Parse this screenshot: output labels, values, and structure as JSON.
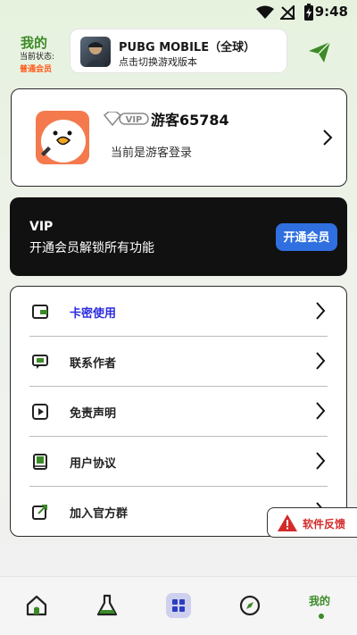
{
  "status_bar": {
    "time": "9:48",
    "icons": [
      "wifi-icon",
      "signal-off-icon",
      "battery-charging-icon"
    ]
  },
  "header": {
    "title": "我的",
    "status_label": "当前状态:",
    "member_level": "普通会员"
  },
  "game_switch": {
    "name": "PUBG MOBILE（全球）",
    "subtitle": "点击切换游戏版本"
  },
  "profile": {
    "vip_badge": "VIP",
    "username": "游客65784",
    "login_state": "当前是游客登录"
  },
  "vip_banner": {
    "title": "VIP",
    "description": "开通会员解锁所有功能",
    "button": "开通会员"
  },
  "menu": [
    {
      "label": "卡密使用",
      "icon": "card-icon",
      "color": "#2b2be0"
    },
    {
      "label": "联系作者",
      "icon": "chat-icon",
      "color": "#222222"
    },
    {
      "label": "免责声明",
      "icon": "play-icon",
      "color": "#222222"
    },
    {
      "label": "用户协议",
      "icon": "book-icon",
      "color": "#222222"
    },
    {
      "label": "加入官方群",
      "icon": "share-icon",
      "color": "#222222"
    }
  ],
  "feedback": {
    "label": "软件反馈"
  },
  "bottom_nav": {
    "active_label": "我的",
    "items": [
      "home-icon",
      "flask-icon",
      "grid-icon",
      "compass-icon"
    ]
  },
  "colors": {
    "accent_green": "#3c8a28",
    "vip_blue": "#2f6fe0",
    "warning_red": "#d42a2a"
  }
}
